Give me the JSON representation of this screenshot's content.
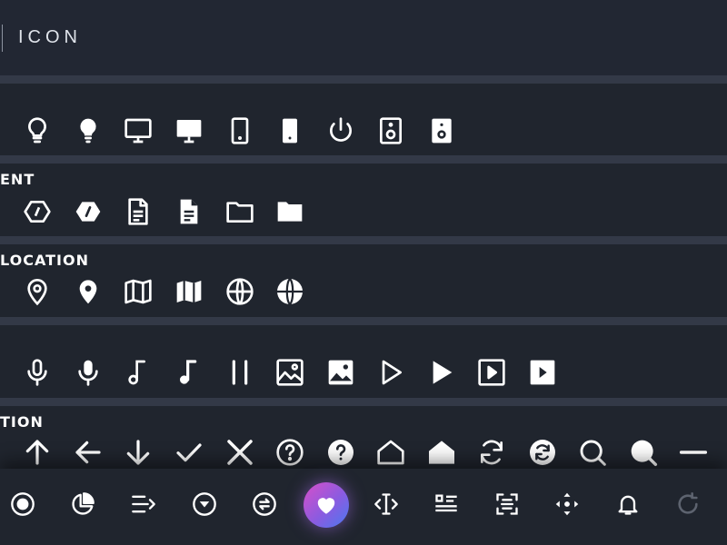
{
  "header": {
    "title": "ICON"
  },
  "categories": [
    {
      "label": ""
    },
    {
      "label": "ENT"
    },
    {
      "label": "LOCATION"
    },
    {
      "label": ""
    },
    {
      "label": "TION"
    }
  ],
  "icons": {
    "row_device": [
      "lightbulb-outline-icon",
      "lightbulb-icon",
      "monitor-outline-icon",
      "monitor-icon",
      "tablet-outline-icon",
      "tablet-icon",
      "power-icon",
      "speaker-outline-icon",
      "speaker-icon"
    ],
    "row_document": [
      "code-outline-icon",
      "code-icon",
      "document-outline-icon",
      "document-icon",
      "folder-outline-icon",
      "folder-icon"
    ],
    "row_location": [
      "location-pin-outline-icon",
      "location-pin-icon",
      "map-outline-icon",
      "map-icon",
      "globe-outline-icon",
      "globe-icon"
    ],
    "row_media": [
      "microphone-outline-icon",
      "microphone-icon",
      "music-note-outline-icon",
      "music-note-icon",
      "pause-icon",
      "image-outline-icon",
      "image-icon",
      "play-outline-icon",
      "play-icon",
      "play-square-outline-icon",
      "play-square-icon"
    ],
    "row_action": [
      "arrow-up-icon",
      "arrow-left-icon",
      "arrow-down-icon",
      "check-icon",
      "close-icon",
      "help-outline-icon",
      "help-icon",
      "home-outline-icon",
      "home-icon",
      "refresh-outline-icon",
      "refresh-icon",
      "search-outline-icon",
      "search-icon",
      "minus-icon"
    ]
  },
  "bottom_nav": [
    "record-icon",
    "pie-chart-icon",
    "list-arrow-icon",
    "dropdown-circle-icon",
    "swap-circle-icon",
    "heart-icon",
    "text-cursor-icon",
    "list-settings-icon",
    "scan-icon",
    "move-icon",
    "bell-icon",
    "loading-icon"
  ],
  "colors": {
    "background": "#20252e",
    "header": "#222733",
    "separator": "#333947",
    "icon": "#ffffff",
    "accent_gradient": [
      "#d84fc9",
      "#4a79f1"
    ]
  }
}
